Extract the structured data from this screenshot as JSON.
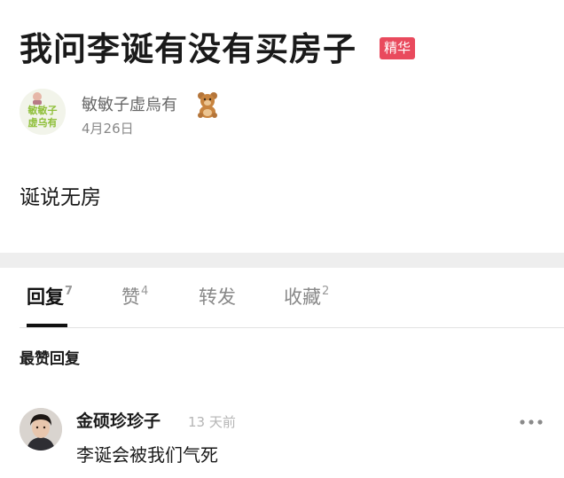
{
  "post": {
    "title": "我问李诞有没有买房子",
    "badge": "精华",
    "author": "敏敏子虚烏有",
    "date": "4月26日",
    "body": "诞说无房",
    "avatar_text_line1": "敏敏子",
    "avatar_text_line2": "虚乌有"
  },
  "tabs": [
    {
      "label": "回复",
      "count": "7"
    },
    {
      "label": "赞",
      "count": "4"
    },
    {
      "label": "转发",
      "count": ""
    },
    {
      "label": "收藏",
      "count": "2"
    }
  ],
  "section": {
    "heading": "最赞回复"
  },
  "comments": [
    {
      "name": "金硕珍珍子",
      "time": "13 天前",
      "text": "李诞会被我们气死"
    }
  ],
  "colors": {
    "badge": "#e94a5d",
    "active_tab": "#111111",
    "separator": "#eeeeee"
  },
  "icons": {
    "author_badge": "teddy-bear-icon",
    "comment_menu": "more-icon"
  }
}
